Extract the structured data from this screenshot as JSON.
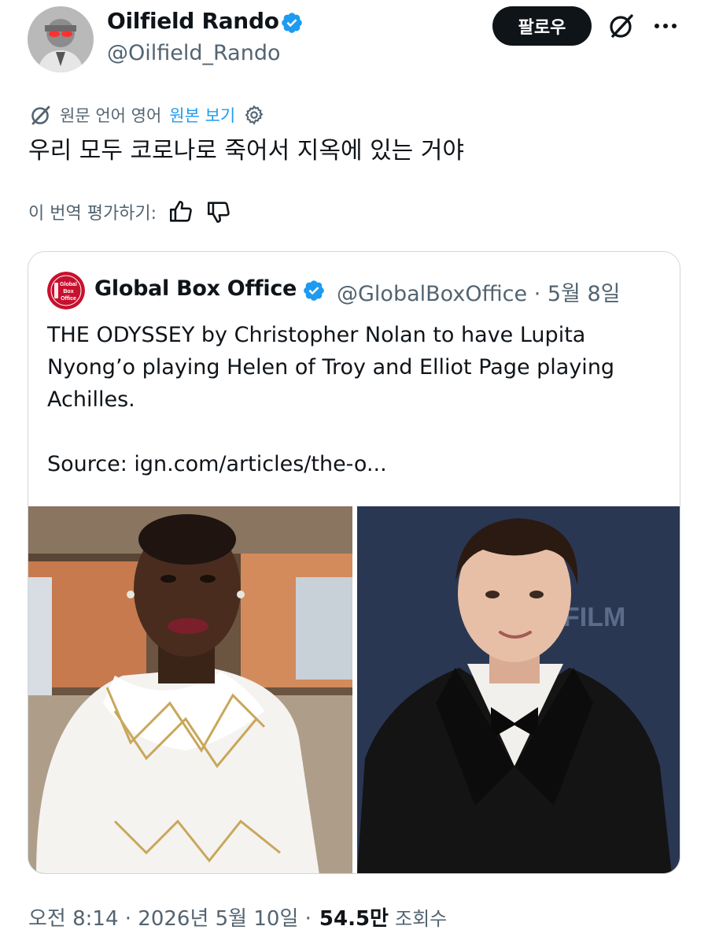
{
  "author": {
    "display_name": "Oilfield Rando",
    "handle": "@Oilfield_Rando",
    "verified": true
  },
  "actions": {
    "follow_label": "팔로우",
    "grok_icon": "grok-icon",
    "more_icon": "more-dots-icon"
  },
  "translation": {
    "source_language_text": "원문 언어 영어",
    "show_original_label": "원본 보기",
    "translated_text": "우리 모두 코로나로 죽어서 지옥에 있는 거야",
    "rate_label": "이 번역 평가하기:"
  },
  "quoted_tweet": {
    "display_name": "Global Box Office",
    "handle_and_date": "@GlobalBoxOffice · 5월 8일",
    "verified": true,
    "text": "THE ODYSSEY by Christopher Nolan to have Lupita Nyong’o playing Helen of Troy and Elliot Page playing Achilles.",
    "source_text": "Source: ign.com/articles/the-o...",
    "avatar_text": [
      "Global",
      "Box",
      "Office"
    ],
    "photos": [
      "portrait-woman-white-embellished-dress",
      "portrait-man-black-tuxedo-bowtie"
    ]
  },
  "meta": {
    "timestamp": "오전 8:14 · 2026년 5월 10일 ·",
    "views_count": "54.5만",
    "views_label": "조회수"
  },
  "colors": {
    "text": "#0f1419",
    "secondary": "#536471",
    "link": "#1d9bf0",
    "verified": "#1d9bf0",
    "border": "#cfd9de",
    "button": "#0f1419"
  }
}
